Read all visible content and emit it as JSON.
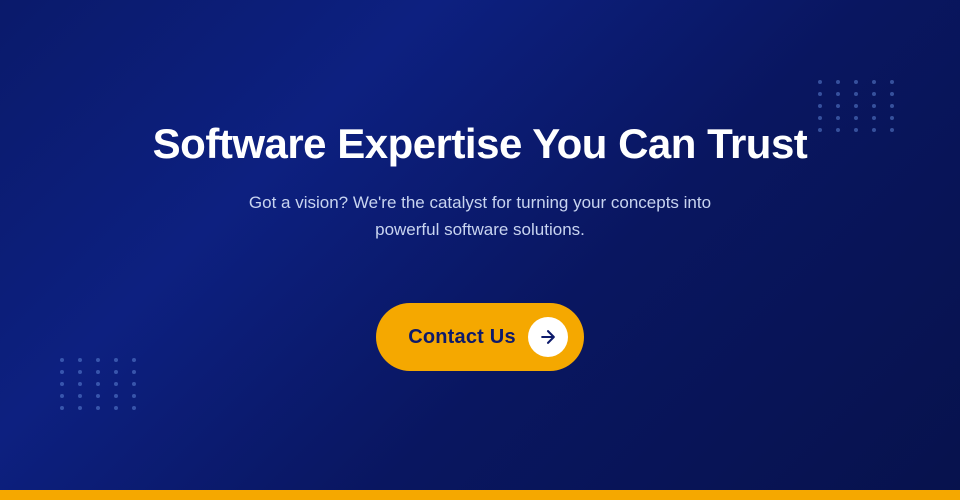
{
  "hero": {
    "title": "Software Expertise You Can Trust",
    "subtitle": "Got a vision? We're the catalyst for turning your concepts into powerful software solutions.",
    "cta_label": "Contact Us",
    "colors": {
      "background_start": "#0a1a6b",
      "background_end": "#07124d",
      "cta_bg": "#f5a800",
      "cta_text": "#0d1a6b",
      "title_text": "#ffffff",
      "subtitle_text": "#c8d4f0",
      "bottom_bar": "#f5a800"
    }
  },
  "dots": {
    "count": 25
  }
}
